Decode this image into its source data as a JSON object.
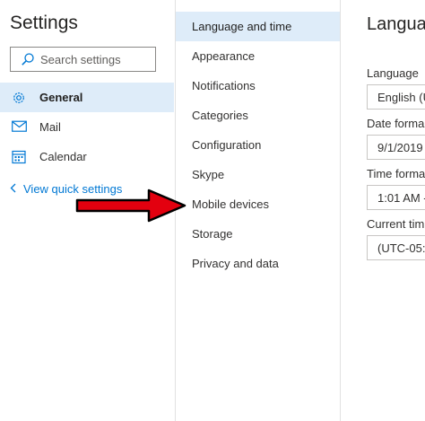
{
  "sidebar": {
    "title": "Settings",
    "search": {
      "placeholder": "Search settings",
      "icon": "search-icon"
    },
    "items": [
      {
        "label": "General",
        "icon": "gear-icon",
        "active": true
      },
      {
        "label": "Mail",
        "icon": "mail-icon",
        "active": false
      },
      {
        "label": "Calendar",
        "icon": "calendar-icon",
        "active": false
      }
    ],
    "view_quick_settings": "View quick settings"
  },
  "categories": {
    "items": [
      {
        "label": "Language and time",
        "active": true
      },
      {
        "label": "Appearance"
      },
      {
        "label": "Notifications"
      },
      {
        "label": "Categories"
      },
      {
        "label": "Configuration"
      },
      {
        "label": "Skype"
      },
      {
        "label": "Mobile devices"
      },
      {
        "label": "Storage"
      },
      {
        "label": "Privacy and data"
      }
    ]
  },
  "panel": {
    "title": "Langua",
    "fields": [
      {
        "label": "Language",
        "value": "English (U"
      },
      {
        "label": "Date forma",
        "value": "9/1/2019"
      },
      {
        "label": "Time forma",
        "value": "1:01 AM -"
      },
      {
        "label": "Current tim",
        "value": "(UTC-05:0"
      }
    ]
  },
  "colors": {
    "active_bg": "#deecf9",
    "link": "#0078d4",
    "arrow_red": "#e3000f"
  }
}
